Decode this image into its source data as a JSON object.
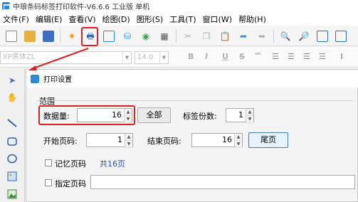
{
  "titlebar": {
    "title": "中琅条码标签打印软件-V6.6.6 工业版 单机"
  },
  "menubar": {
    "items": [
      "文件(F)",
      "编辑(E)",
      "查看(V)",
      "绘图(D)",
      "图形(S)",
      "工具(T)",
      "窗口(W)",
      "帮助(H)"
    ]
  },
  "toolbar1": {
    "icons": [
      "new-file-icon",
      "open-folder-icon",
      "save-icon",
      "settings-gear-icon",
      "print-icon",
      "print-preview-icon",
      "database-icon",
      "layers-icon",
      "grid-icon",
      "cut-icon",
      "copy-icon",
      "paste-icon",
      "undo-icon",
      "redo-icon",
      "zoom-in-icon",
      "zoom-out-icon",
      "zoom-fit-icon",
      "zoom-actual-icon"
    ]
  },
  "toolbar2": {
    "font_name": "XP黑体ZL",
    "font_size": "14.0",
    "bold": "B",
    "italic": "I",
    "underline": "U",
    "strike": "S"
  },
  "dialog": {
    "title": "打印设置",
    "range_label": "范围",
    "data_count_label": "数据量:",
    "data_count_value": "16",
    "all_button": "全部",
    "copies_label": "标签份数:",
    "copies_value": "1",
    "start_page_label": "开始页码:",
    "start_page_value": "1",
    "end_page_label": "结束页码:",
    "end_page_value": "16",
    "last_page_button": "尾页",
    "remember_page_label": "记忆页码",
    "total_pages_text": "共16页",
    "specified_page_label": "指定页码"
  },
  "colors": {
    "highlight": "#e02020",
    "accent": "#2a8ad8",
    "link": "#1f4fd1"
  }
}
